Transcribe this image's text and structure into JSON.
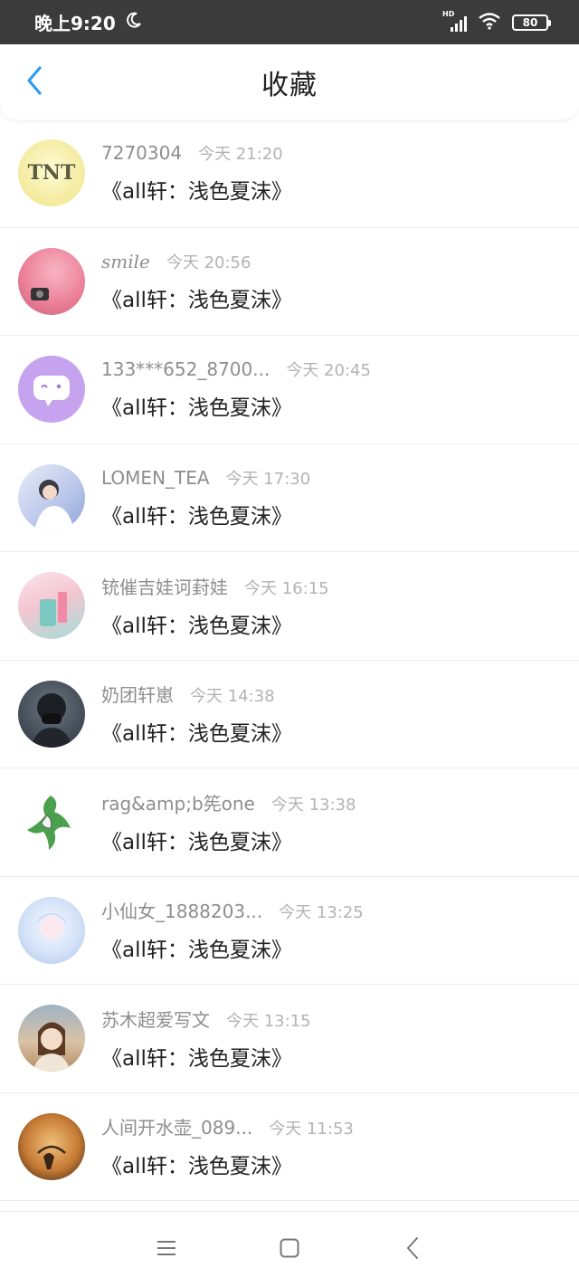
{
  "status_bar": {
    "time": "晚上9:20",
    "network_label": "HD",
    "battery": "80"
  },
  "header": {
    "title": "收藏"
  },
  "items": [
    {
      "user": "7270304",
      "time": "今天 21:20",
      "title": "《all轩：浅色夏沫》",
      "avatar_color": "#f6f0a6"
    },
    {
      "user": "smile",
      "time": "今天 20:56",
      "title": "《all轩：浅色夏沫》",
      "avatar_color": "#f28aa0"
    },
    {
      "user": "133***652_8700...",
      "time": "今天 20:45",
      "title": "《all轩：浅色夏沫》",
      "avatar_color": "#c9a7f0"
    },
    {
      "user": "LOMEN_TEA",
      "time": "今天 17:30",
      "title": "《all轩：浅色夏沫》",
      "avatar_color": "#cfd6f2"
    },
    {
      "user": "铳催吉娃诃葑娃",
      "time": "今天 16:15",
      "title": "《all轩：浅色夏沫》",
      "avatar_color": "#9fd8d4"
    },
    {
      "user": "奶团轩崽",
      "time": "今天 14:38",
      "title": "《all轩：浅色夏沫》",
      "avatar_color": "#46525e"
    },
    {
      "user": "rag&amp;b筅one",
      "time": "今天 13:38",
      "title": "《all轩：浅色夏沫》",
      "avatar_color": "#ffffff"
    },
    {
      "user": "小仙女_1888203...",
      "time": "今天 13:25",
      "title": "《all轩：浅色夏沫》",
      "avatar_color": "#d7e4f7"
    },
    {
      "user": "苏木超爱写文",
      "time": "今天 13:15",
      "title": "《all轩：浅色夏沫》",
      "avatar_color": "#c9b59a"
    },
    {
      "user": "人间开水壶_089...",
      "time": "今天 11:53",
      "title": "《all轩：浅色夏沫》",
      "avatar_color": "#a9652b"
    }
  ],
  "colors": {
    "accent": "#2f9bf0",
    "status_bar_bg": "#3b3b3b"
  }
}
